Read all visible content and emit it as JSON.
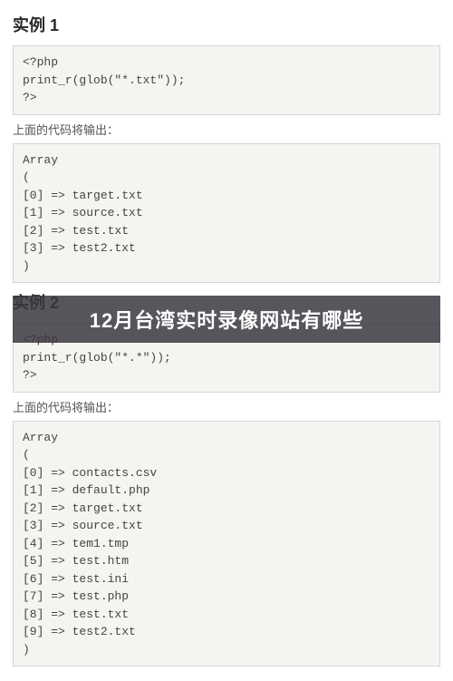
{
  "example1": {
    "heading": "实例 1",
    "code": "<?php\nprint_r(glob(\"*.txt\"));\n?>",
    "output_label": "上面的代码将输出：",
    "output": "Array\n(\n[0] => target.txt\n[1] => source.txt\n[2] => test.txt\n[3] => test2.txt\n)"
  },
  "example2": {
    "heading": "实例 2",
    "code": "<?php\nprint_r(glob(\"*.*\"));\n?>",
    "output_label": "上面的代码将输出：",
    "output": "Array\n(\n[0] => contacts.csv\n[1] => default.php\n[2] => target.txt\n[3] => source.txt\n[4] => tem1.tmp\n[5] => test.htm\n[6] => test.ini\n[7] => test.php\n[8] => test.txt\n[9] => test2.txt\n)"
  },
  "overlay": {
    "text": "12月台湾实时录像网站有哪些"
  }
}
